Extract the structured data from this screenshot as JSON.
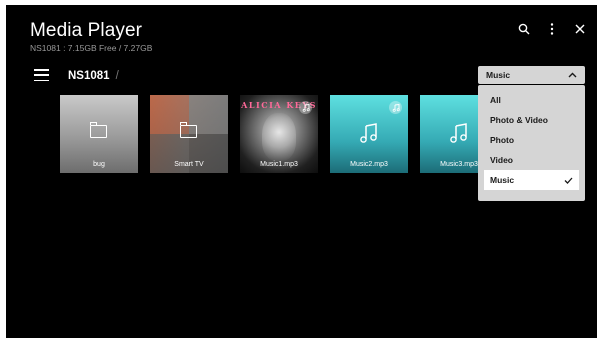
{
  "app": {
    "title": "Media Player",
    "storage_info": "NS1081 : 7.15GB Free / 7.27GB"
  },
  "top_icons": [
    "search-icon",
    "more-vertical-icon",
    "close-icon"
  ],
  "breadcrumb": {
    "current": "NS1081",
    "separator": "/"
  },
  "filter": {
    "selected_label": "Music",
    "options": [
      {
        "label": "All",
        "selected": false
      },
      {
        "label": "Photo & Video",
        "selected": false
      },
      {
        "label": "Photo",
        "selected": false
      },
      {
        "label": "Video",
        "selected": false
      },
      {
        "label": "Music",
        "selected": true
      }
    ]
  },
  "tiles": [
    {
      "name": "bug",
      "type": "folder"
    },
    {
      "name": "Smart TV",
      "type": "folder"
    },
    {
      "name": "Music1.mp3",
      "type": "album",
      "album_text": "ALICIA KEYS"
    },
    {
      "name": "Music2.mp3",
      "type": "music"
    },
    {
      "name": "Music3.mp3",
      "type": "music"
    }
  ],
  "colors": {
    "background": "#000000",
    "dropdown_bg": "#d5d5d5",
    "music_tile": "#45c4c9"
  }
}
